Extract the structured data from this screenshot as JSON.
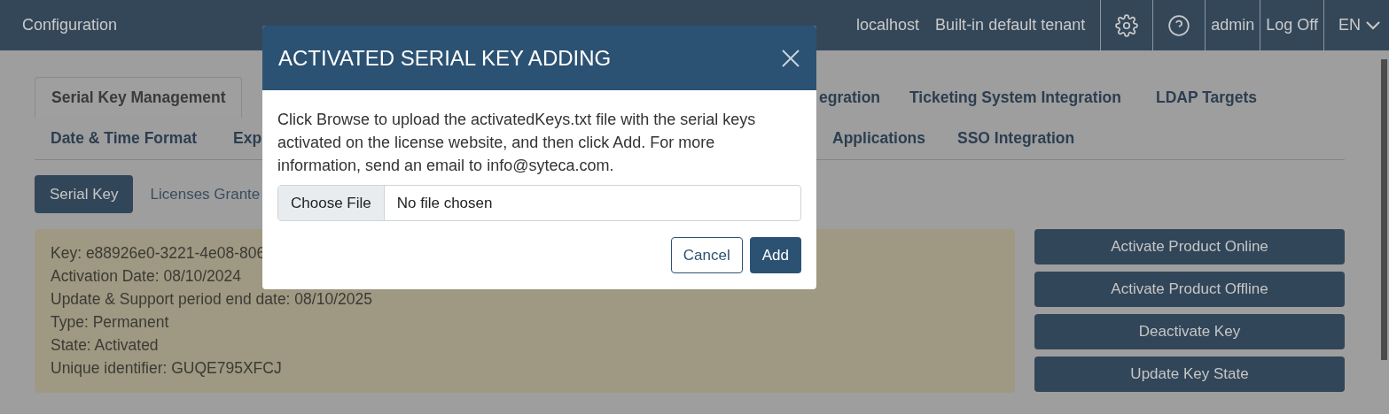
{
  "header": {
    "title": "Configuration",
    "server": "localhost",
    "tenant": "Built-in default tenant",
    "user": "admin",
    "logoff": "Log Off",
    "language": "EN"
  },
  "tabs_row_1": [
    {
      "label": "Serial Key Management",
      "selected": true
    },
    {
      "label": "egration",
      "selected": false
    },
    {
      "label": "Ticketing System Integration",
      "selected": false
    },
    {
      "label": "LDAP Targets",
      "selected": false
    }
  ],
  "tabs_row_2": [
    {
      "label": "Date & Time Format",
      "selected": false
    },
    {
      "label": "Exp",
      "selected": false
    },
    {
      "label": "Applications",
      "selected": false
    },
    {
      "label": "SSO Integration",
      "selected": false
    }
  ],
  "subtabs": [
    {
      "label": "Serial Key",
      "selected": true
    },
    {
      "label": "Licenses Grante",
      "selected": false
    }
  ],
  "key_info": [
    "Key: e88926e0-3221-4e08-806",
    "Activation Date: 08/10/2024",
    "Update & Support period end date: 08/10/2025",
    "Type: Permanent",
    "State: Activated",
    "Unique identifier: GUQE795XFCJ"
  ],
  "actions": [
    "Activate Product Online",
    "Activate Product Offline",
    "Deactivate Key",
    "Update Key State"
  ],
  "dialog": {
    "title": "ACTIVATED SERIAL KEY ADDING",
    "message": "Click Browse to upload the activatedKeys.txt file with the serial keys activated on the license website, and then click Add. For more information, send an email to info@syteca.com.",
    "file_button": "Choose File",
    "file_status": "No file chosen",
    "cancel": "Cancel",
    "add": "Add"
  }
}
